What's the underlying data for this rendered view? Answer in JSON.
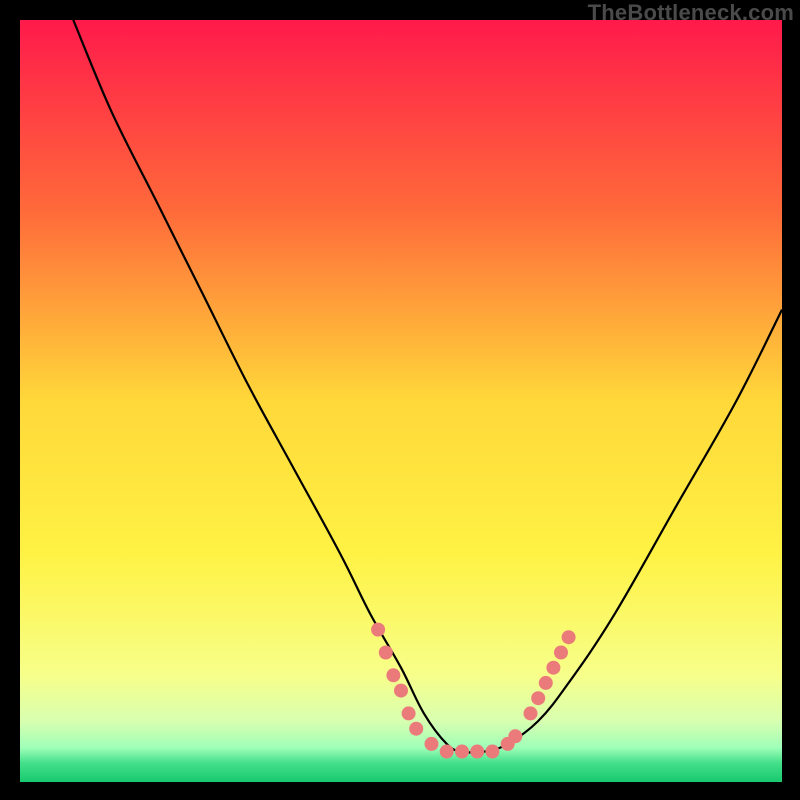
{
  "attribution": "TheBottleneck.com",
  "colors": {
    "background": "#000000",
    "curve": "#000000",
    "marker": "#eb7b7b",
    "gradient_stops": [
      {
        "offset": 0.0,
        "color": "#ff1a4b"
      },
      {
        "offset": 0.25,
        "color": "#ff6a3a"
      },
      {
        "offset": 0.5,
        "color": "#ffd83a"
      },
      {
        "offset": 0.7,
        "color": "#fff244"
      },
      {
        "offset": 0.86,
        "color": "#f7ff8a"
      },
      {
        "offset": 0.92,
        "color": "#d8ffb0"
      },
      {
        "offset": 0.955,
        "color": "#9fffb8"
      },
      {
        "offset": 0.975,
        "color": "#44e08a"
      },
      {
        "offset": 1.0,
        "color": "#18c96f"
      }
    ]
  },
  "chart_data": {
    "type": "line",
    "title": "",
    "xlabel": "",
    "ylabel": "",
    "xlim": [
      0,
      100
    ],
    "ylim": [
      0,
      100
    ],
    "series": [
      {
        "name": "bottleneck-curve",
        "x": [
          7,
          12,
          18,
          24,
          30,
          36,
          42,
          46,
          50,
          53,
          56,
          58,
          61,
          64,
          68,
          72,
          78,
          86,
          94,
          100
        ],
        "values": [
          100,
          88,
          76,
          64,
          52,
          41,
          30,
          22,
          15,
          9,
          5,
          4,
          4,
          5,
          8,
          13,
          22,
          36,
          50,
          62
        ]
      }
    ],
    "markers": {
      "left_cluster": [
        {
          "x": 47,
          "y": 20
        },
        {
          "x": 48,
          "y": 17
        },
        {
          "x": 49,
          "y": 14
        },
        {
          "x": 50,
          "y": 12
        },
        {
          "x": 51,
          "y": 9
        },
        {
          "x": 52,
          "y": 7
        }
      ],
      "bottom_cluster": [
        {
          "x": 54,
          "y": 5
        },
        {
          "x": 56,
          "y": 4
        },
        {
          "x": 58,
          "y": 4
        },
        {
          "x": 60,
          "y": 4
        },
        {
          "x": 62,
          "y": 4
        },
        {
          "x": 64,
          "y": 5
        },
        {
          "x": 65,
          "y": 6
        }
      ],
      "right_cluster": [
        {
          "x": 67,
          "y": 9
        },
        {
          "x": 68,
          "y": 11
        },
        {
          "x": 69,
          "y": 13
        },
        {
          "x": 70,
          "y": 15
        },
        {
          "x": 71,
          "y": 17
        },
        {
          "x": 72,
          "y": 19
        }
      ]
    }
  }
}
